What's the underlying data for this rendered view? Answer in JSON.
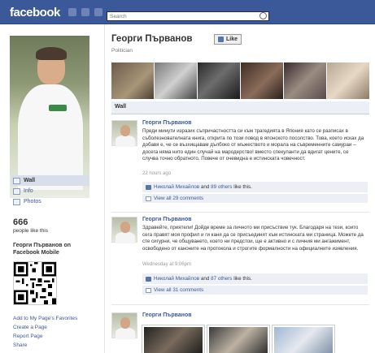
{
  "topbar": {
    "logo": "facebook",
    "search_placeholder": "Search"
  },
  "profile": {
    "name": "Георги Първанов",
    "category": "Politician",
    "like_button": "Like",
    "likes_count": "666",
    "likes_label": "people like this",
    "mobile_title": "Георги Първанов on Facebook Mobile"
  },
  "nav": [
    {
      "label": "Wall",
      "active": true
    },
    {
      "label": "Info",
      "active": false
    },
    {
      "label": "Photos",
      "active": false
    }
  ],
  "links": [
    "Add to My Page's Favorites",
    "Create a Page",
    "Report Page",
    "Share"
  ],
  "tabs": {
    "wall": "Wall"
  },
  "posts": [
    {
      "author": "Георги Първанов",
      "text": "Преди минути изразих съпричастността си към трагедията в Япония като се разписах в съболезнователната книга, открита по този повод в японското посолство. Това, което исках да добавя е, че се възхищавам дълбоко от мъжеството и морала на съвременните самураи – досега няма нито един случай на мародерство! вместо спекуланти да вдигат цените, се случва точно обратното. Повече от очевидна е истинската човечност.",
      "time": "22 hours ago",
      "like_name": "Николай Михайлов",
      "like_and": "and",
      "like_others": "89 others",
      "like_suffix": "like this.",
      "comments": "View all 29 comments"
    },
    {
      "author": "Георги Първанов",
      "text": "Здравейте, приятели! Дойде време за личното ми присъствие тук. Благодаря на тези, които сега правят моя профил и ги каня да се присъединят към истинската ми страница. Можете да сте сигурни, че общуването, което ни предстои, ще е активно и с личния ми ангажимент, освободено от каноните на протокола и строгите формалности на официалните изявления.",
      "time": "Wednesday at 9:06pm",
      "like_name": "Николай Михайлов",
      "like_and": "and",
      "like_others": "87 others",
      "like_suffix": "like this.",
      "comments": "View all 31 comments"
    },
    {
      "author": "Георги Първанов"
    }
  ],
  "colors": {
    "brand": "#3b5998",
    "link": "#3b5998",
    "panel": "#eceff5"
  }
}
